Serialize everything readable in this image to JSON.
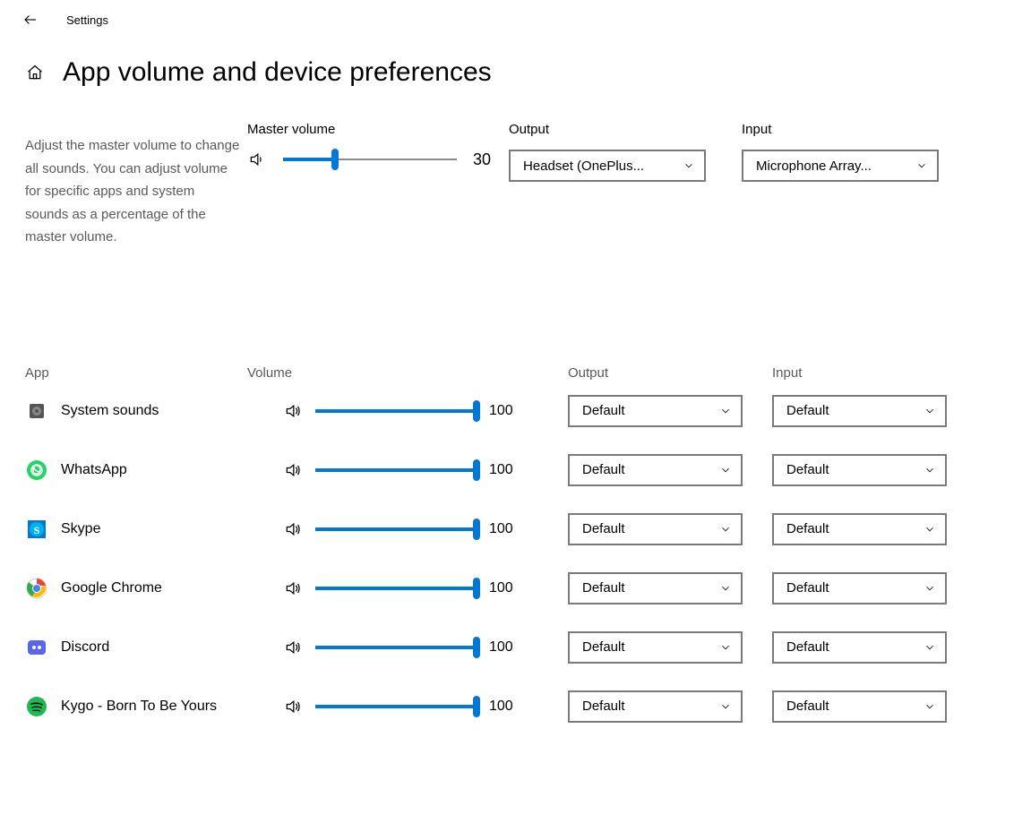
{
  "topbar": {
    "title": "Settings"
  },
  "page": {
    "title": "App volume and device preferences"
  },
  "description": "Adjust the master volume to change all sounds. You can adjust volume for specific apps and system sounds as a percentage of the master volume.",
  "master": {
    "label": "Master volume",
    "output_label": "Output",
    "input_label": "Input",
    "volume": 30,
    "output": "Headset (OnePlus...",
    "input": "Microphone Array..."
  },
  "app_headers": {
    "app": "App",
    "volume": "Volume",
    "output": "Output",
    "input": "Input"
  },
  "apps": [
    {
      "name": "System sounds",
      "volume": 100,
      "output": "Default",
      "input": "Default",
      "icon": "system"
    },
    {
      "name": "WhatsApp",
      "volume": 100,
      "output": "Default",
      "input": "Default",
      "icon": "whatsapp"
    },
    {
      "name": "Skype",
      "volume": 100,
      "output": "Default",
      "input": "Default",
      "icon": "skype"
    },
    {
      "name": "Google Chrome",
      "volume": 100,
      "output": "Default",
      "input": "Default",
      "icon": "chrome"
    },
    {
      "name": "Discord",
      "volume": 100,
      "output": "Default",
      "input": "Default",
      "icon": "discord"
    },
    {
      "name": "Kygo - Born To Be Yours",
      "volume": 100,
      "output": "Default",
      "input": "Default",
      "icon": "spotify"
    }
  ]
}
